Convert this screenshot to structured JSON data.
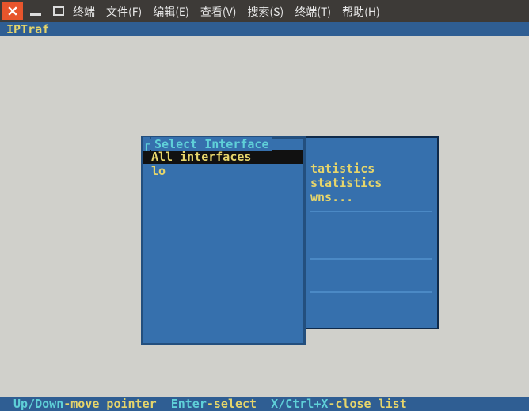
{
  "window": {
    "menubar": [
      "终端",
      "文件(F)",
      "编辑(E)",
      "查看(V)",
      "搜索(S)",
      "终端(T)",
      "帮助(H)"
    ]
  },
  "app": {
    "title": "IPTraf"
  },
  "select_box": {
    "title": "Select Interface",
    "items": [
      {
        "label": "All interfaces",
        "selected": true
      },
      {
        "label": "lo",
        "selected": false
      }
    ]
  },
  "bg_box": {
    "lines": [
      "tatistics",
      "statistics",
      "wns..."
    ]
  },
  "statusbar": {
    "k1": " Up/Down",
    "d1": "-move pointer  ",
    "k2": "Enter",
    "d2": "-select  ",
    "k3": "X/Ctrl+X",
    "d3": "-close list"
  }
}
